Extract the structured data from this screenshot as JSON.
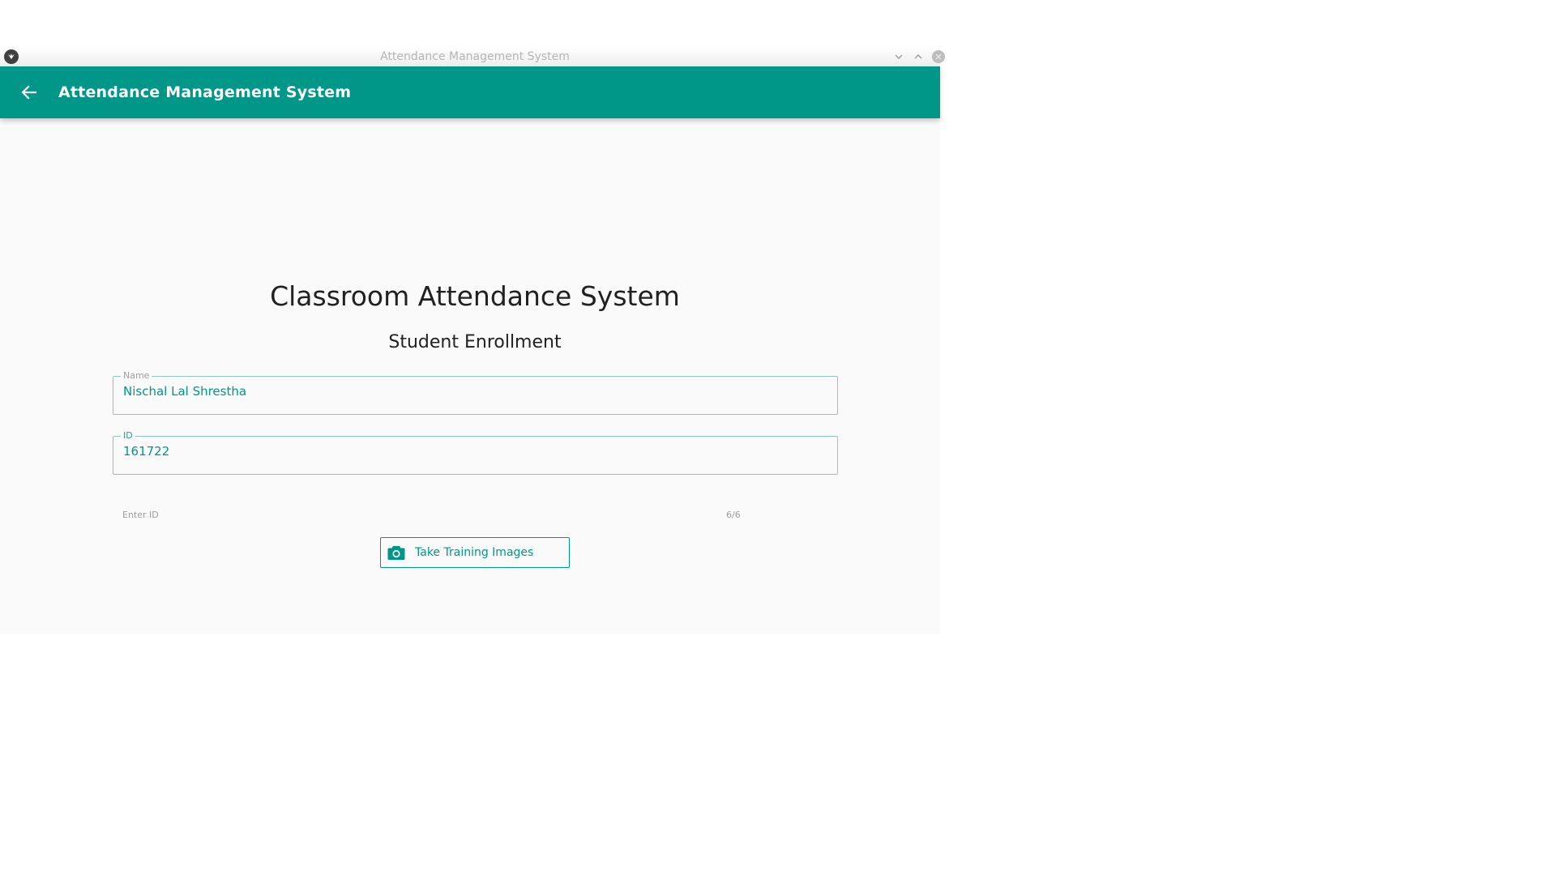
{
  "window": {
    "title": "Attendance Management System"
  },
  "toolbar": {
    "title": "Attendance Management System",
    "back_icon": "arrow-left-icon"
  },
  "page": {
    "heading": "Classroom Attendance System",
    "subheading": "Student Enrollment"
  },
  "form": {
    "name": {
      "label": "Name",
      "value": "Nischal Lal Shrestha"
    },
    "id": {
      "label": "ID",
      "value": "161722",
      "hint": "Enter ID",
      "counter": "6/6"
    },
    "train_button": {
      "icon": "camera-icon",
      "label": "Take Training Images"
    }
  },
  "colors": {
    "primary": "#009688",
    "background": "#fafafa",
    "text_dark": "#212121",
    "text_hint": "#9e9e9e"
  }
}
